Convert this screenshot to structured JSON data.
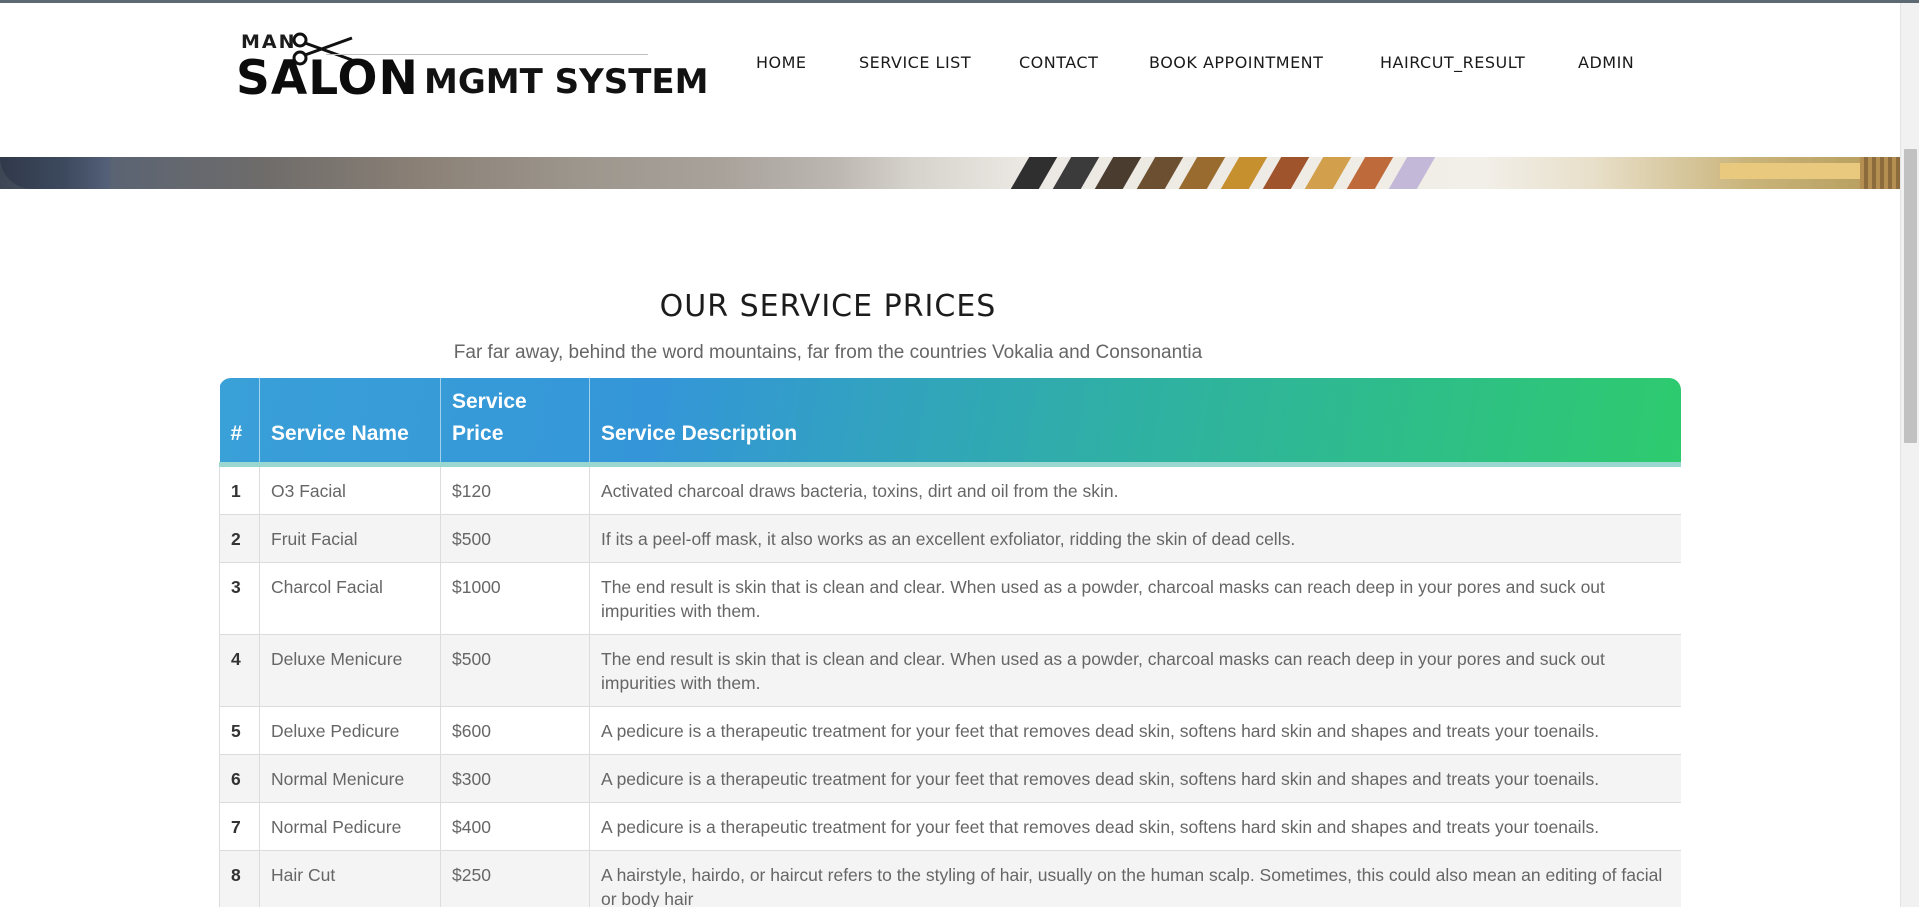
{
  "logo": {
    "top": "MAN",
    "salon": "SALON",
    "rest": "MGMT SYSTEM"
  },
  "nav": {
    "items": [
      {
        "label": "HOME"
      },
      {
        "label": "SERVICE LIST"
      },
      {
        "label": "CONTACT"
      },
      {
        "label": "BOOK APPOINTMENT"
      },
      {
        "label": "HAIRCUT_RESULT"
      },
      {
        "label": "ADMIN"
      }
    ]
  },
  "section": {
    "title": "OUR SERVICE PRICES",
    "subtitle": "Far far away, behind the word mountains, far from the countries Vokalia and Consonantia"
  },
  "table": {
    "headers": [
      "#",
      "Service Name",
      "Service Price",
      "Service Description"
    ],
    "rows": [
      {
        "num": "1",
        "name": "O3 Facial",
        "price": "$120",
        "desc": "Activated charcoal draws bacteria, toxins, dirt and oil from the skin."
      },
      {
        "num": "2",
        "name": "Fruit Facial",
        "price": "$500",
        "desc": "If its a peel-off mask, it also works as an excellent exfoliator, ridding the skin of dead cells."
      },
      {
        "num": "3",
        "name": "Charcol Facial",
        "price": "$1000",
        "desc": "The end result is skin that is clean and clear. When used as a powder, charcoal masks can reach deep in your pores and suck out impurities with them."
      },
      {
        "num": "4",
        "name": "Deluxe Menicure",
        "price": "$500",
        "desc": "The end result is skin that is clean and clear. When used as a powder, charcoal masks can reach deep in your pores and suck out impurities with them."
      },
      {
        "num": "5",
        "name": "Deluxe Pedicure",
        "price": "$600",
        "desc": "A pedicure is a therapeutic treatment for your feet that removes dead skin, softens hard skin and shapes and treats your toenails."
      },
      {
        "num": "6",
        "name": "Normal Menicure",
        "price": "$300",
        "desc": "A pedicure is a therapeutic treatment for your feet that removes dead skin, softens hard skin and shapes and treats your toenails."
      },
      {
        "num": "7",
        "name": "Normal Pedicure",
        "price": "$400",
        "desc": "A pedicure is a therapeutic treatment for your feet that removes dead skin, softens hard skin and shapes and treats your toenails."
      },
      {
        "num": "8",
        "name": "Hair Cut",
        "price": "$250",
        "desc": "A hairstyle, hairdo, or haircut refers to the styling of hair, usually on the human scalp. Sometimes, this could also mean an editing of facial or body hair"
      }
    ]
  },
  "colors": {
    "header_gradient_start": "#3aa0d8",
    "header_gradient_end": "#2ecb6e",
    "row_alt": "#f4f4f4"
  }
}
